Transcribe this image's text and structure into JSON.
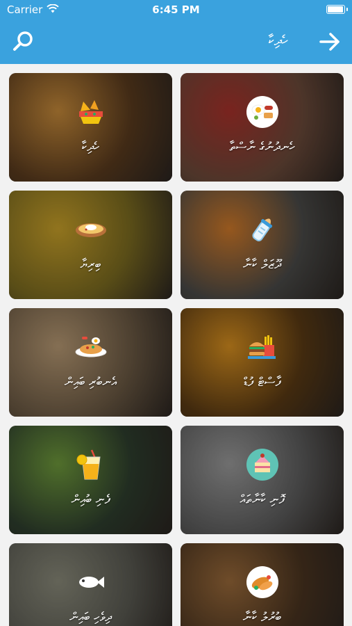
{
  "status_bar": {
    "carrier": "Carrier",
    "time": "6:45 PM",
    "battery_level": 1.0
  },
  "header": {
    "title": "ހެދިކާ"
  },
  "categories": [
    {
      "label": "ހެނދުނުގެ ނާސްތާ",
      "icon": "breakfast-plate-icon",
      "bg": "#6b4a3a",
      "accent": "#a8322b"
    },
    {
      "label": "ހެދިކާ",
      "icon": "nachos-icon",
      "bg": "#5a3b1e",
      "accent": "#c68a3a"
    },
    {
      "label": "ދޫޒަލް ކާނާ",
      "icon": "baby-bottle-icon",
      "bg": "#4a4a48",
      "accent": "#d07a2a"
    },
    {
      "label": "ބިރިޔާ",
      "icon": "curry-bowl-icon",
      "bg": "#7a6a20",
      "accent": "#c9a12a"
    },
    {
      "label": "ފާސްޓް ފުޑް",
      "icon": "fast-food-icon",
      "bg": "#5a3a14",
      "accent": "#d89020"
    },
    {
      "label": "އެނބުރި ބައިން",
      "icon": "rice-dish-icon",
      "bg": "#6c5a44",
      "accent": "#b89a74"
    },
    {
      "label": "ފޮނި ކާނާތައް",
      "icon": "dessert-icon",
      "bg": "#5c5c5c",
      "accent": "#9a9a9a"
    },
    {
      "label": "ފެނި ބުއިން",
      "icon": "juice-glass-icon",
      "bg": "#2e3e2e",
      "accent": "#6f9a3c"
    },
    {
      "label": "ބުރުލު ކާނާ",
      "icon": "fried-food-icon",
      "bg": "#4a3420",
      "accent": "#9a6a3a"
    },
    {
      "label": "ދިވެހި ބައިން",
      "icon": "fish-icon",
      "bg": "#5a5a52",
      "accent": "#8a8a7a"
    }
  ]
}
